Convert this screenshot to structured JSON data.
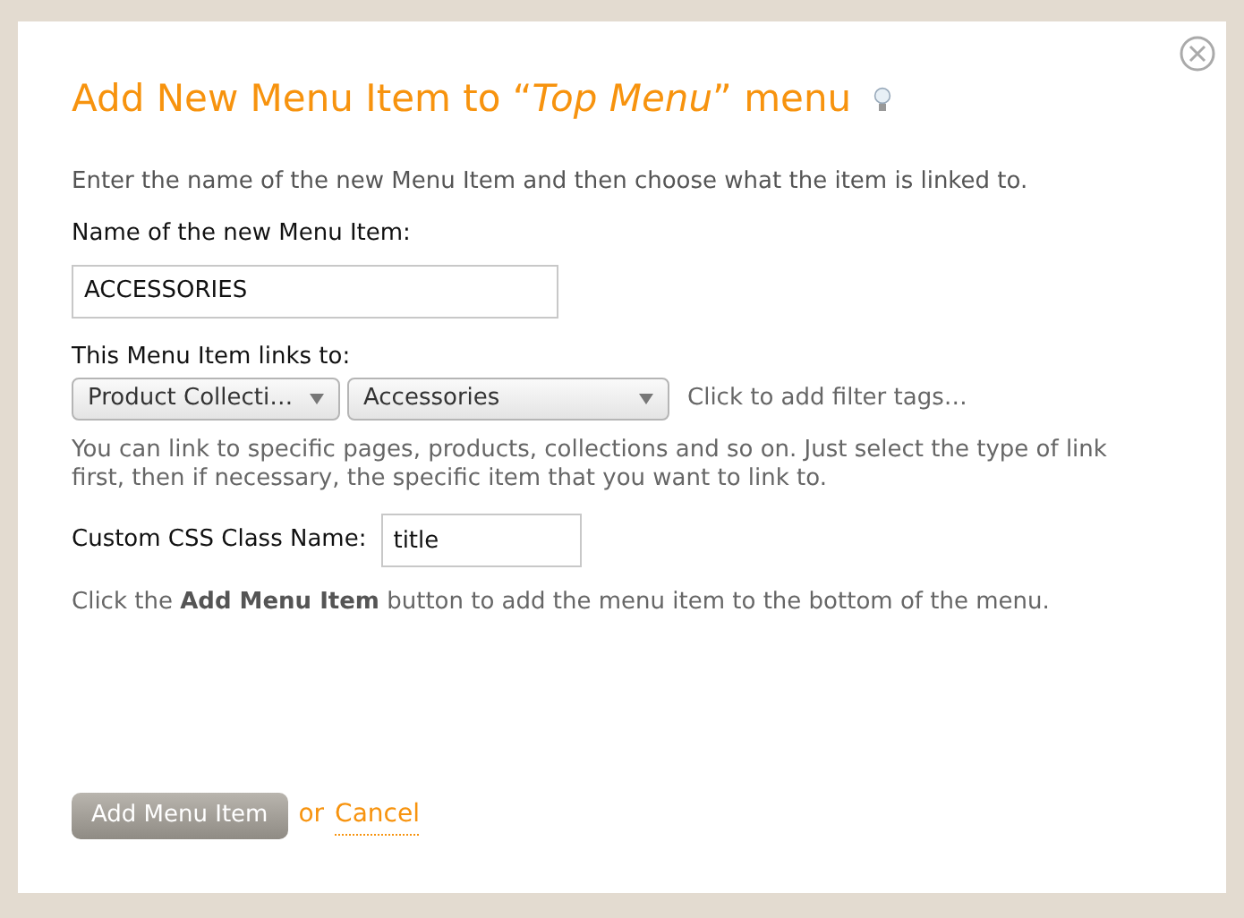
{
  "dialog": {
    "title": "Add New Menu Item to “*Top Menu*” menu",
    "intro": "Enter the name of the new Menu Item and then choose what the item is linked to.",
    "name_field": {
      "label": "Name of the new Menu Item:",
      "value": "ACCESSORIES"
    },
    "link": {
      "label": "This Menu Item links to:",
      "type_select": "Product Collecti…",
      "target_select": "Accessories",
      "filter_tags": "Click to add filter tags…",
      "help": "You can link to specific pages, products, collections and so on. Just select the type of link first, then if necessary, the specific item that you want to link to."
    },
    "css_field": {
      "label": "Custom CSS Class Name:",
      "value": "title"
    },
    "hint": "Click the **Add Menu Item** button to add the menu item to the bottom of the menu.",
    "buttons": {
      "submit": "Add Menu Item",
      "or": "or",
      "cancel": "Cancel"
    }
  }
}
